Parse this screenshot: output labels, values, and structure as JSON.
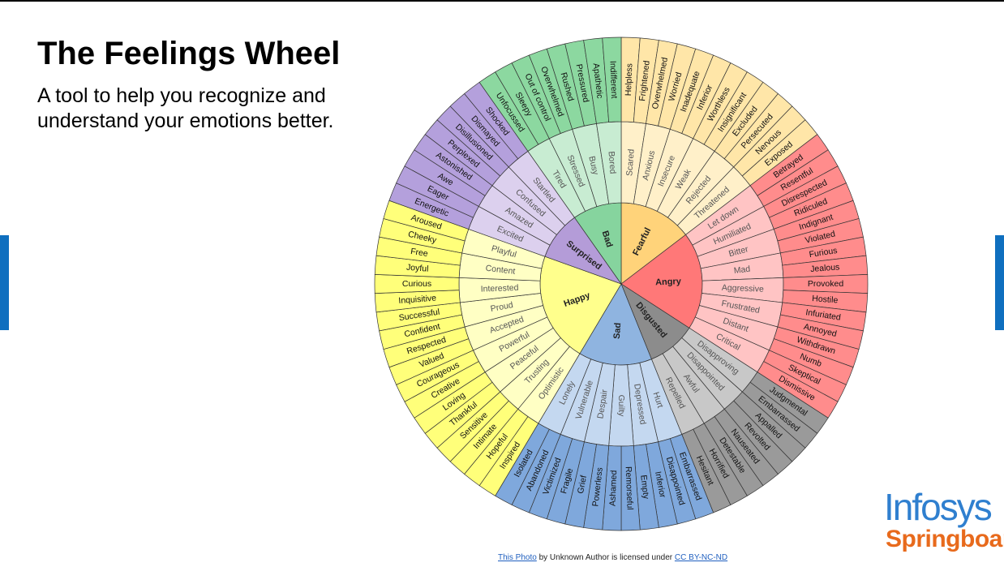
{
  "slide": {
    "title": "The Feelings Wheel",
    "subtitle": "A tool to help you recognize and understand your emotions better."
  },
  "wheel": {
    "core": [
      {
        "label": "Fearful",
        "color": "#ffd37a",
        "outer_color": "#ffe6a8",
        "mid_color": "#fff0c9",
        "middle": [
          {
            "label": "Scared",
            "outer": [
              "Helpless",
              "Frightened"
            ]
          },
          {
            "label": "Anxious",
            "outer": [
              "Overwhelmed",
              "Worried"
            ]
          },
          {
            "label": "Insecure",
            "outer": [
              "Inadequate",
              "Inferior"
            ]
          },
          {
            "label": "Weak",
            "outer": [
              "Worthless",
              "Insignificant"
            ]
          },
          {
            "label": "Rejected",
            "outer": [
              "Excluded",
              "Persecuted"
            ]
          },
          {
            "label": "Threatened",
            "outer": [
              "Nervous",
              "Exposed"
            ]
          }
        ]
      },
      {
        "label": "Angry",
        "color": "#ff7878",
        "outer_color": "#ff8c8c",
        "mid_color": "#ffc4c4",
        "middle": [
          {
            "label": "Let down",
            "outer": [
              "Betrayed",
              "Resentful"
            ]
          },
          {
            "label": "Humiliated",
            "outer": [
              "Disrespected",
              "Ridiculed"
            ]
          },
          {
            "label": "Bitter",
            "outer": [
              "Indignant",
              "Violated"
            ]
          },
          {
            "label": "Mad",
            "outer": [
              "Furious",
              "Jealous"
            ]
          },
          {
            "label": "Aggressive",
            "outer": [
              "Provoked",
              "Hostile"
            ]
          },
          {
            "label": "Frustrated",
            "outer": [
              "Infuriated",
              "Annoyed"
            ]
          },
          {
            "label": "Distant",
            "outer": [
              "Withdrawn",
              "Numb"
            ]
          },
          {
            "label": "Critical",
            "outer": [
              "Skeptical",
              "Dismissive"
            ]
          }
        ]
      },
      {
        "label": "Disgusted",
        "color": "#8c8c8c",
        "outer_color": "#9a9a9a",
        "mid_color": "#c8c8c8",
        "middle": [
          {
            "label": "Disapproving",
            "outer": [
              "Judgmental",
              "Embarrassed"
            ]
          },
          {
            "label": "Disappointed",
            "outer": [
              "Appalled",
              "Revolted"
            ]
          },
          {
            "label": "Awful",
            "outer": [
              "Nauseated",
              "Detestable"
            ]
          },
          {
            "label": "Repelled",
            "outer": [
              "Horrified",
              "Hesitant"
            ]
          }
        ]
      },
      {
        "label": "Sad",
        "color": "#8fb4e0",
        "outer_color": "#7fa8dc",
        "mid_color": "#c4d8f0",
        "middle": [
          {
            "label": "Hurt",
            "outer": [
              "Embarrassed",
              "Disappointed"
            ]
          },
          {
            "label": "Depressed",
            "outer": [
              "Inferior",
              "Empty"
            ]
          },
          {
            "label": "Guilty",
            "outer": [
              "Remorseful",
              "Ashamed"
            ]
          },
          {
            "label": "Despair",
            "outer": [
              "Powerless",
              "Grief"
            ]
          },
          {
            "label": "Vulnerable",
            "outer": [
              "Fragile",
              "Victimized"
            ]
          },
          {
            "label": "Lonely",
            "outer": [
              "Abandoned",
              "Isolated"
            ]
          }
        ]
      },
      {
        "label": "Happy",
        "color": "#ffff8c",
        "outer_color": "#ffff7a",
        "mid_color": "#ffffc4",
        "middle": [
          {
            "label": "Optimistic",
            "outer": [
              "Inspired",
              "Hopeful"
            ]
          },
          {
            "label": "Trusting",
            "outer": [
              "Intimate",
              "Sensitive"
            ]
          },
          {
            "label": "Peaceful",
            "outer": [
              "Thankful",
              "Loving"
            ]
          },
          {
            "label": "Powerful",
            "outer": [
              "Creative",
              "Courageous"
            ]
          },
          {
            "label": "Accepted",
            "outer": [
              "Valued",
              "Respected"
            ]
          },
          {
            "label": "Proud",
            "outer": [
              "Confident",
              "Successful"
            ]
          },
          {
            "label": "Interested",
            "outer": [
              "Inquisitive",
              "Curious"
            ]
          },
          {
            "label": "Content",
            "outer": [
              "Joyful",
              "Free"
            ]
          },
          {
            "label": "Playful",
            "outer": [
              "Cheeky",
              "Aroused"
            ]
          }
        ]
      },
      {
        "label": "Surprised",
        "color": "#b49cd8",
        "outer_color": "#b4a0dc",
        "mid_color": "#dcd0ee",
        "middle": [
          {
            "label": "Excited",
            "outer": [
              "Energetic",
              "Eager"
            ]
          },
          {
            "label": "Amazed",
            "outer": [
              "Awe",
              "Astonished"
            ]
          },
          {
            "label": "Confused",
            "outer": [
              "Perplexed",
              "Disillusioned"
            ]
          },
          {
            "label": "Startled",
            "outer": [
              "Dismayed",
              "Shocked"
            ]
          }
        ]
      },
      {
        "label": "Bad",
        "color": "#86d49e",
        "outer_color": "#8cd8a0",
        "mid_color": "#c8ecd2",
        "middle": [
          {
            "label": "Tired",
            "outer": [
              "Unfocussed",
              "Sleepy"
            ]
          },
          {
            "label": "Stressed",
            "outer": [
              "Out of control",
              "Overwhelmed"
            ]
          },
          {
            "label": "Busy",
            "outer": [
              "Rushed",
              "Pressured"
            ]
          },
          {
            "label": "Bored",
            "outer": [
              "Apathetic",
              "Indifferent"
            ]
          }
        ]
      }
    ]
  },
  "caption": {
    "link1": "This Photo",
    "middle": " by Unknown Author is licensed under ",
    "link2": "CC BY-NC-ND"
  },
  "logo": {
    "line1": "Infosys",
    "line2": "Springboard"
  }
}
